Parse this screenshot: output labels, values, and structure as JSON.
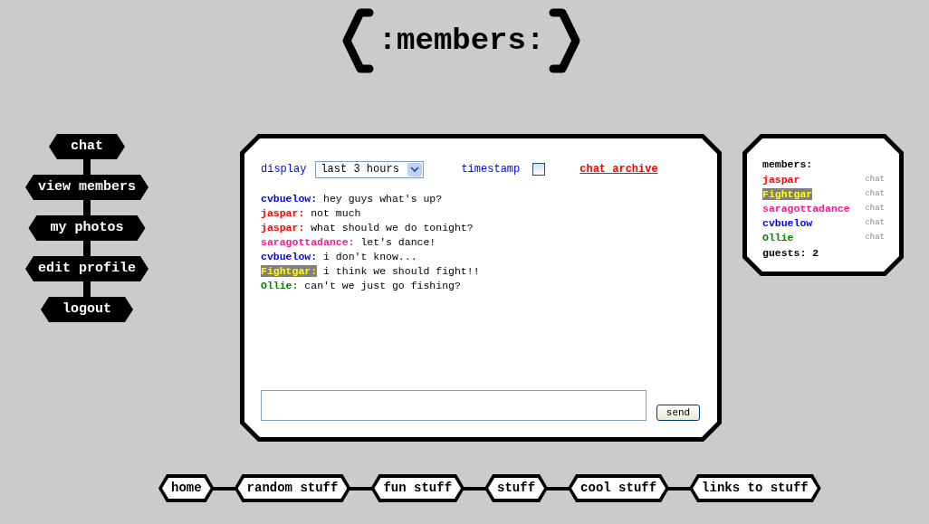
{
  "logo": {
    "text": ":members:"
  },
  "sidebar": {
    "items": [
      {
        "label": "chat"
      },
      {
        "label": "view members"
      },
      {
        "label": "my photos"
      },
      {
        "label": "edit profile"
      },
      {
        "label": "logout"
      }
    ]
  },
  "chat": {
    "display_label": "display",
    "display_value": "last 3 hours",
    "timestamp_label": "timestamp",
    "timestamp_checked": false,
    "archive_link": "chat archive",
    "messages": [
      {
        "user": "cvbuelow:",
        "color": "#0000ff",
        "highlighted": false,
        "text": "hey guys what's up?"
      },
      {
        "user": "jaspar:",
        "color": "#ff0000",
        "highlighted": false,
        "text": "not much"
      },
      {
        "user": "jaspar:",
        "color": "#ff0000",
        "highlighted": false,
        "text": "what should we do tonight?"
      },
      {
        "user": "saragottadance:",
        "color": "#ff1493",
        "highlighted": false,
        "text": "let's dance!"
      },
      {
        "user": "cvbuelow:",
        "color": "#0000ff",
        "highlighted": false,
        "text": "i don't know..."
      },
      {
        "user": "Fightgar:",
        "color": "#808080",
        "highlighted": true,
        "text": "i think we should fight!!"
      },
      {
        "user": "Ollie:",
        "color": "#008000",
        "highlighted": false,
        "text": "can't we just go fishing?"
      }
    ],
    "send_button": "send"
  },
  "members_panel": {
    "title": "members:",
    "members": [
      {
        "name": "jaspar",
        "color": "#ff0000",
        "highlighted": false,
        "action": "chat"
      },
      {
        "name": "Fightgar",
        "color": "#808080",
        "highlighted": true,
        "action": "chat"
      },
      {
        "name": "saragottadance",
        "color": "#ff1493",
        "highlighted": false,
        "action": "chat"
      },
      {
        "name": "cvbuelow",
        "color": "#0000ff",
        "highlighted": false,
        "action": "chat"
      },
      {
        "name": "Ollie",
        "color": "#008000",
        "highlighted": false,
        "action": "chat"
      }
    ],
    "guests": "guests: 2"
  },
  "bottom_nav": {
    "items": [
      {
        "label": "home"
      },
      {
        "label": "random stuff"
      },
      {
        "label": "fun stuff"
      },
      {
        "label": "stuff"
      },
      {
        "label": "cool stuff"
      },
      {
        "label": "links to stuff"
      }
    ]
  }
}
